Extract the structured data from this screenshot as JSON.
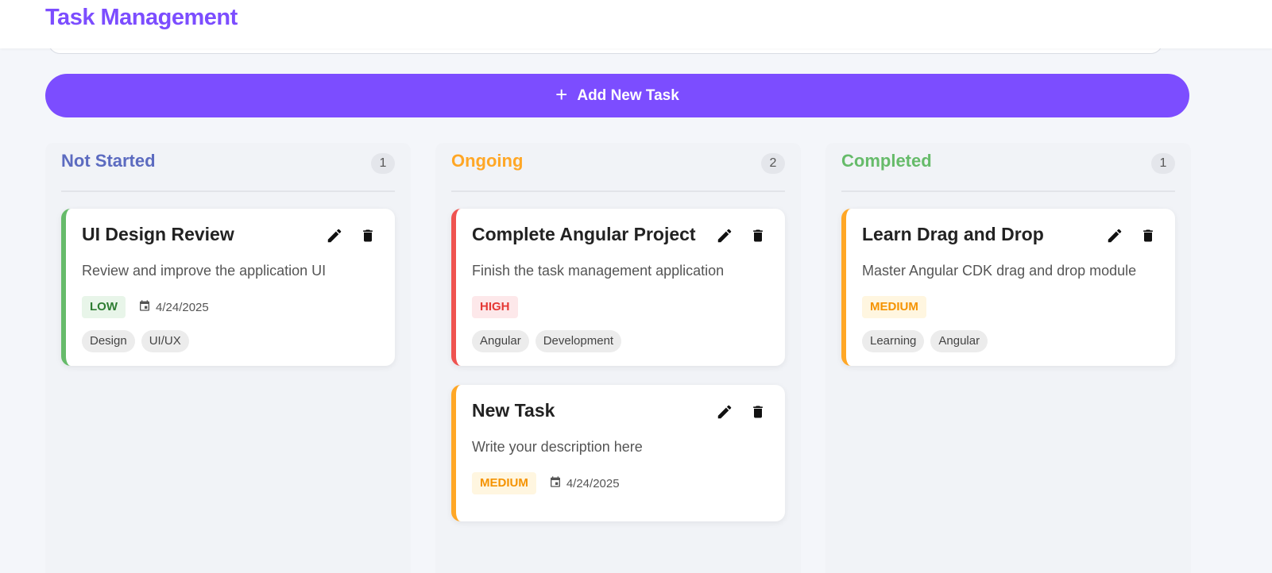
{
  "header": {
    "title": "Task Management"
  },
  "add_button": {
    "label": "Add New Task"
  },
  "colors": {
    "accent": "#7c4dff",
    "not_started": "#5c6bc0",
    "ongoing": "#ffa726",
    "completed": "#66bb6a",
    "priority_low_bg": "#e8f5e9",
    "priority_low_fg": "#2e7d32",
    "priority_medium_bg": "#fff6e0",
    "priority_medium_fg": "#f59300",
    "priority_high_bg": "#fde8ea",
    "priority_high_fg": "#e53935"
  },
  "columns": [
    {
      "title": "Not Started",
      "count": "1",
      "cards": [
        {
          "title": "UI Design Review",
          "description": "Review and improve the application UI",
          "priority": "LOW",
          "due_date": "4/24/2025",
          "tags": [
            "Design",
            "UI/UX"
          ]
        }
      ]
    },
    {
      "title": "Ongoing",
      "count": "2",
      "cards": [
        {
          "title": "Complete Angular Project",
          "description": "Finish the task management application",
          "priority": "HIGH",
          "tags": [
            "Angular",
            "Development"
          ]
        },
        {
          "title": "New Task",
          "description": "Write your description here",
          "priority": "MEDIUM",
          "due_date": "4/24/2025"
        }
      ]
    },
    {
      "title": "Completed",
      "count": "1",
      "cards": [
        {
          "title": "Learn Drag and Drop",
          "description": "Master Angular CDK drag and drop module",
          "priority": "MEDIUM",
          "tags": [
            "Learning",
            "Angular"
          ]
        }
      ]
    }
  ],
  "icons": {
    "add": "plus-icon",
    "edit": "pencil-icon",
    "delete": "trash-icon",
    "date": "calendar-icon"
  }
}
